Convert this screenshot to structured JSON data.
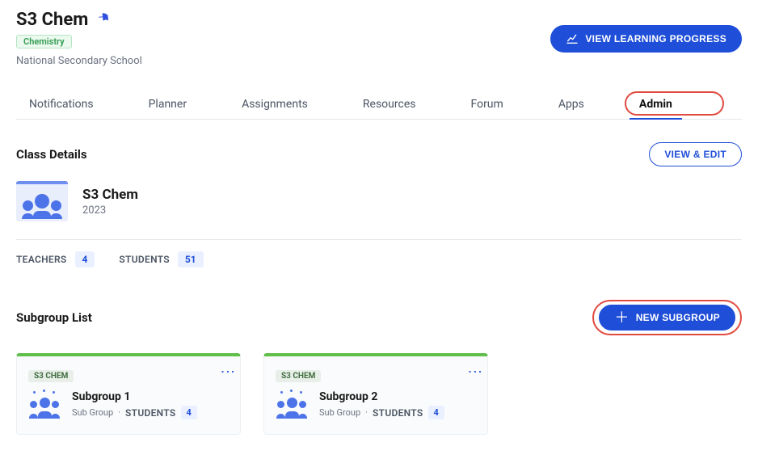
{
  "header": {
    "title": "S3 Chem",
    "subject_badge": "Chemistry",
    "school": "National Secondary School",
    "view_progress_label": "VIEW LEARNING PROGRESS"
  },
  "tabs": [
    {
      "label": "Notifications",
      "active": false
    },
    {
      "label": "Planner",
      "active": false
    },
    {
      "label": "Assignments",
      "active": false
    },
    {
      "label": "Resources",
      "active": false
    },
    {
      "label": "Forum",
      "active": false
    },
    {
      "label": "Apps",
      "active": false
    },
    {
      "label": "Admin",
      "active": true
    }
  ],
  "class_details": {
    "section_title": "Class Details",
    "view_edit_label": "VIEW & EDIT",
    "class_name": "S3 Chem",
    "class_year": "2023",
    "teachers_label": "TEACHERS",
    "teachers_count": "4",
    "students_label": "STUDENTS",
    "students_count": "51"
  },
  "subgroups": {
    "section_title": "Subgroup List",
    "new_label": "NEW SUBGROUP",
    "chip_label": "S3 CHEM",
    "subgroup_meta_label": "Sub Group",
    "students_label": "STUDENTS",
    "items": [
      {
        "name": "Subgroup 1",
        "students": "4"
      },
      {
        "name": "Subgroup 2",
        "students": "4"
      }
    ]
  }
}
